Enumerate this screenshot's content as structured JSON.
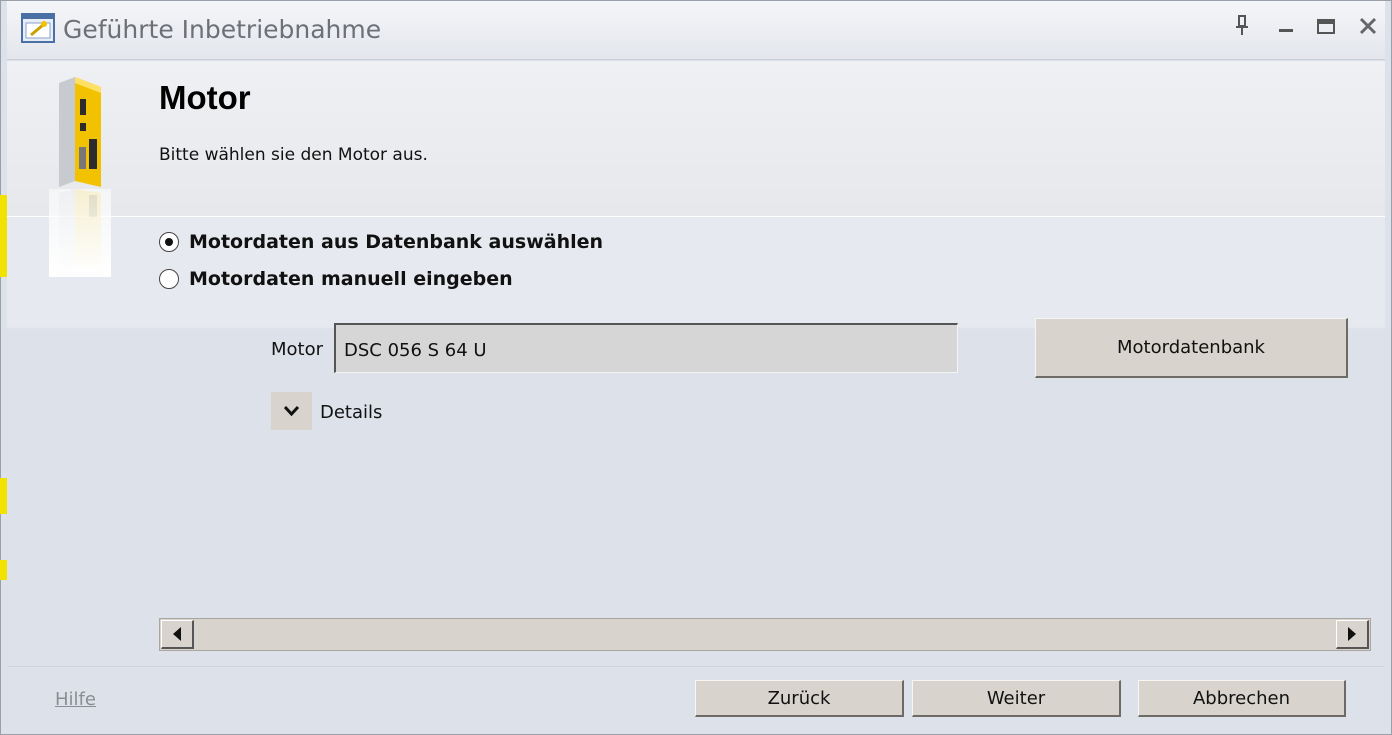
{
  "window": {
    "title": "Geführte Inbetriebnahme"
  },
  "header": {
    "title": "Motor",
    "subtitle": "Bitte wählen sie den Motor aus."
  },
  "options": {
    "database": "Motordaten aus Datenbank auswählen",
    "manual": "Motordaten manuell eingeben",
    "selected": "database"
  },
  "motor": {
    "label": "Motor",
    "value": "DSC 056 S 64 U",
    "database_button": "Motordatenbank"
  },
  "details": {
    "label": "Details"
  },
  "footer": {
    "help": "Hilfe",
    "back": "Zurück",
    "next": "Weiter",
    "cancel": "Abbrechen"
  },
  "icons": {
    "app": "wizard-icon",
    "pin": "pin-icon",
    "minimize": "minimize-icon",
    "maximize": "maximize-icon",
    "close": "close-icon",
    "device": "drive-device-icon",
    "chevron": "chevron-down-icon",
    "scroll_left": "arrow-left-icon",
    "scroll_right": "arrow-right-icon"
  },
  "colors": {
    "accent_yellow": "#f2c200",
    "button_face": "#d8d4cd",
    "panel": "#dde2ea"
  }
}
